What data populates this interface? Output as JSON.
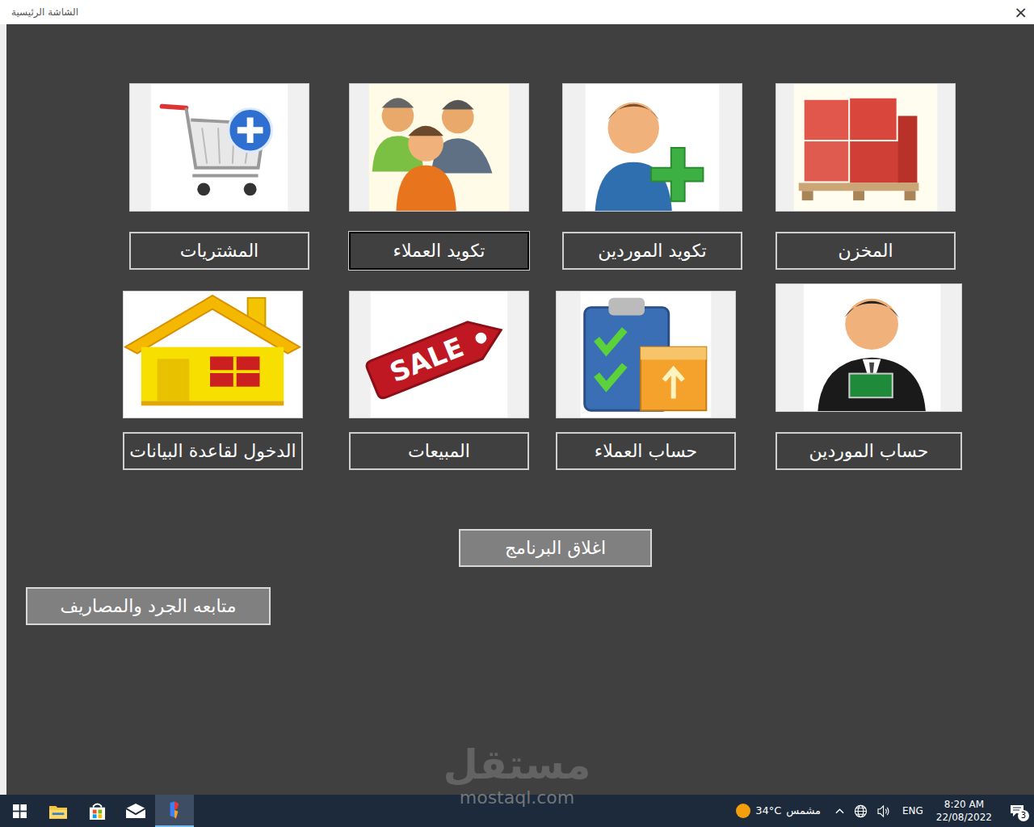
{
  "window": {
    "title": "الشاشة الرئيسية",
    "close": "×"
  },
  "tiles": [
    {
      "label": "المشتريات",
      "kind": "cart",
      "focused": false
    },
    {
      "label": "تكويد العملاء",
      "kind": "people",
      "focused": true
    },
    {
      "label": "تكويد الموردين",
      "kind": "person-add",
      "focused": false
    },
    {
      "label": "المخزن",
      "kind": "boxes",
      "focused": false
    },
    {
      "label": "الدخول لقاعدة البيانات",
      "kind": "house",
      "focused": false
    },
    {
      "label": "المبيعات",
      "kind": "sale",
      "focused": false,
      "tag_text": "SALE"
    },
    {
      "label": "حساب العملاء",
      "kind": "clipboard",
      "focused": false
    },
    {
      "label": "حساب الموردين",
      "kind": "salesman",
      "focused": false
    }
  ],
  "buttons": {
    "close_program": "اغلاق البرنامج",
    "inventory": "متابعه الجرد والمصاريف"
  },
  "watermark": {
    "arabic": "مستقل",
    "latin": "mostaql.com"
  },
  "taskbar": {
    "apps": [
      {
        "kind": "start",
        "selected": false
      },
      {
        "kind": "explorer",
        "selected": false
      },
      {
        "kind": "store",
        "selected": false
      },
      {
        "kind": "mail",
        "selected": false
      },
      {
        "kind": "app",
        "selected": true
      }
    ],
    "temperature": "34°C",
    "weather": "مشمس",
    "language": "ENG",
    "time": "8:20 AM",
    "date": "22/08/2022",
    "notifications": "3"
  }
}
